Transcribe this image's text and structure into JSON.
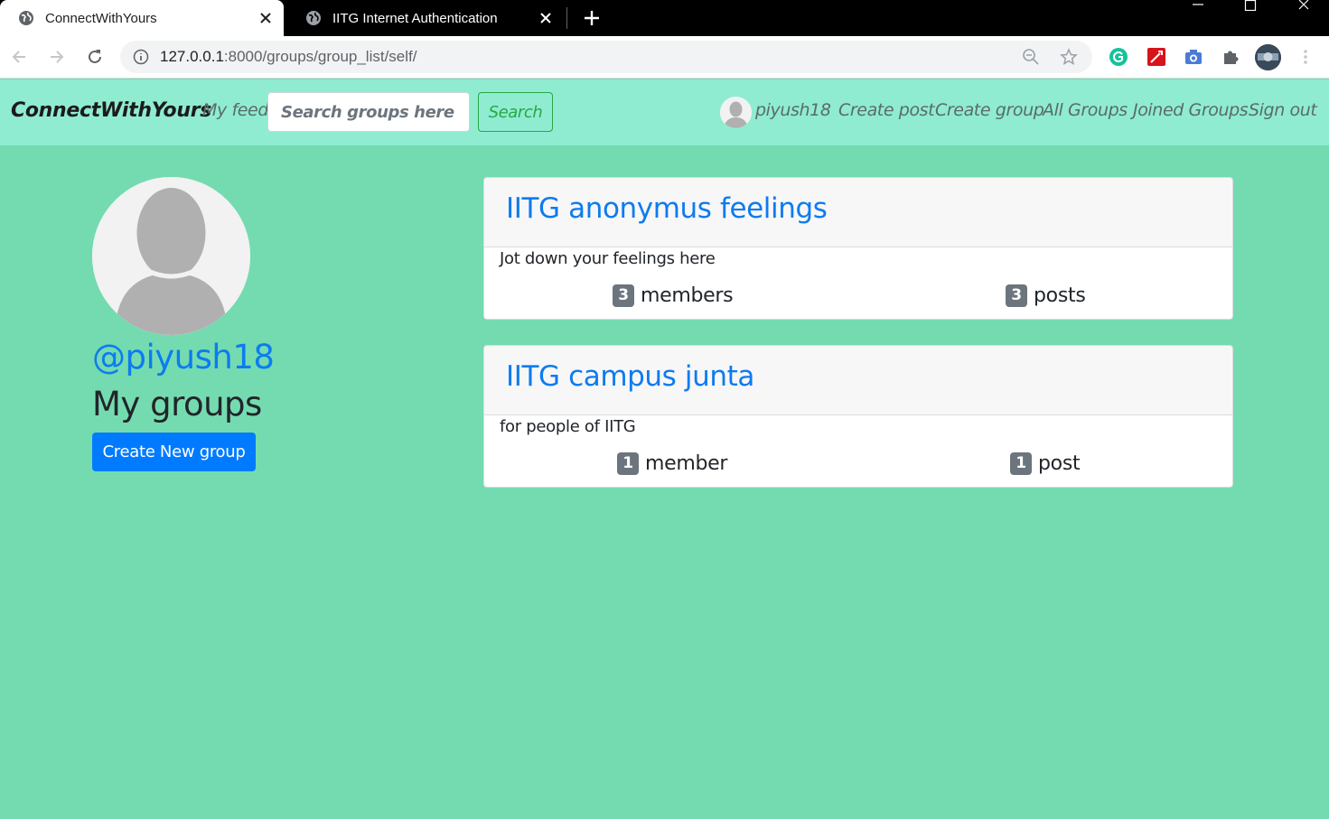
{
  "browser": {
    "tabs": [
      {
        "title": "ConnectWithYours",
        "active": true
      },
      {
        "title": "IITG Internet Authentication",
        "active": false
      }
    ],
    "url_host": "127.0.0.1",
    "url_rest": ":8000/groups/group_list/self/"
  },
  "navbar": {
    "brand": "ConnectWithYours",
    "my_feed": "My feed",
    "search_placeholder": "Search groups here",
    "search_button": "Search",
    "username": "piyush18",
    "links": {
      "create_post": "Create post",
      "create_group": "Create group",
      "all_groups": "All Groups",
      "joined_groups": "Joined Groups",
      "sign_out": "Sign out"
    }
  },
  "sidebar": {
    "handle": "@piyush18",
    "heading": "My groups",
    "create_button": "Create New group"
  },
  "groups": [
    {
      "name": "IITG anonymus feelings",
      "description": "Jot down your feelings here",
      "member_count": "3",
      "member_label": "members",
      "post_count": "3",
      "post_label": "posts"
    },
    {
      "name": "IITG campus junta",
      "description": "for people of IITG",
      "member_count": "1",
      "member_label": "member",
      "post_count": "1",
      "post_label": "post"
    }
  ],
  "colors": {
    "page_bg": "#74dbb0",
    "navbar_bg": "#8fecd1",
    "link_blue": "#0d7bf0",
    "success_green": "#28a745",
    "primary": "#007bff",
    "badge_gray": "#6c757d"
  }
}
